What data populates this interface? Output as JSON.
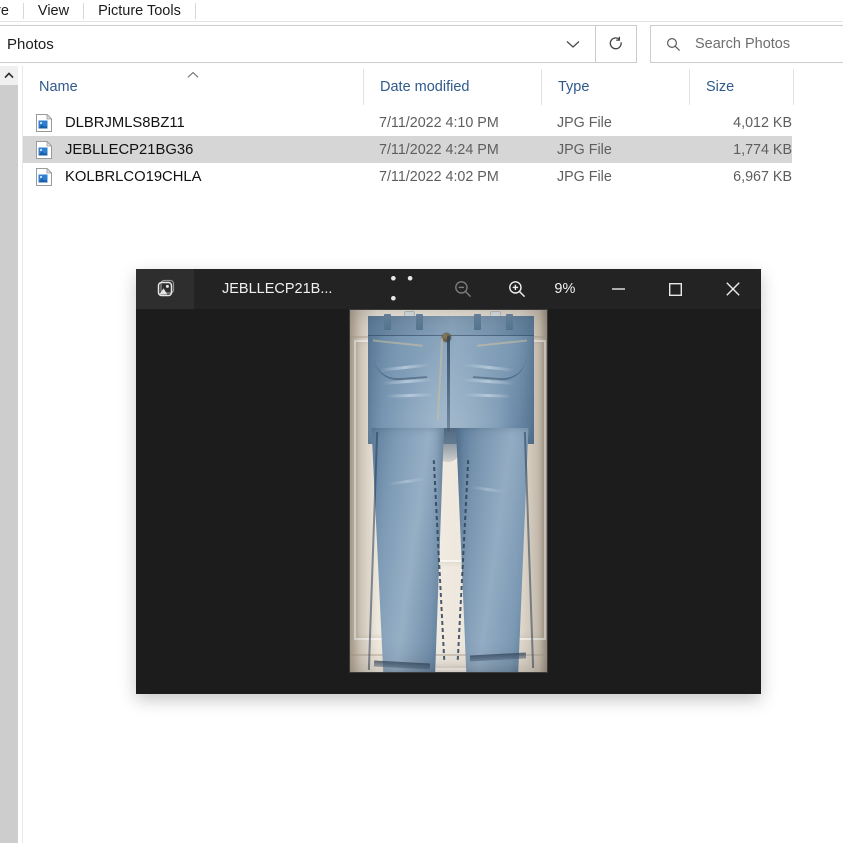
{
  "ribbon": {
    "tabs": [
      {
        "label": "re",
        "name": "tab-share-cut"
      },
      {
        "label": "View",
        "name": "tab-view"
      },
      {
        "label": "Picture Tools",
        "name": "tab-picture-tools"
      }
    ]
  },
  "addressbar": {
    "path": "Photos",
    "dropdown_icon": "chevron-down-icon",
    "refresh_icon": "refresh-icon"
  },
  "search": {
    "placeholder": "Search Photos",
    "icon": "search-icon",
    "value": ""
  },
  "columns": [
    {
      "label": "Name",
      "sorted": "asc"
    },
    {
      "label": "Date modified",
      "sorted": ""
    },
    {
      "label": "Type",
      "sorted": ""
    },
    {
      "label": "Size",
      "sorted": ""
    }
  ],
  "files": [
    {
      "name": "DLBRJMLS8BZ11",
      "date_modified": "7/11/2022 4:10 PM",
      "type": "JPG File",
      "size": "4,012 KB",
      "selected": false
    },
    {
      "name": "JEBLLECP21BG36",
      "date_modified": "7/11/2022 4:24 PM",
      "type": "JPG File",
      "size": "1,774 KB",
      "selected": true
    },
    {
      "name": "KOLBRLCO19CHLA",
      "date_modified": "7/11/2022 4:02 PM",
      "type": "JPG File",
      "size": "6,967 KB",
      "selected": false
    }
  ],
  "viewer": {
    "app_icon": "photos-app-icon",
    "title": "JEBLLECP21B...",
    "more_label": "• • •",
    "zoom_out_icon": "zoom-out-icon",
    "zoom_in_icon": "zoom-in-icon",
    "zoom_level": "9%",
    "minimize_icon": "minimize-icon",
    "maximize_icon": "maximize-icon",
    "close_icon": "close-icon",
    "photo_alt": "blue-jeans-hanging-on-white-door"
  },
  "colors": {
    "selection": "#d6d6d6",
    "column_header_text": "#2f5a8c",
    "viewer_titlebar": "#232323",
    "viewer_canvas": "#1c1c1c",
    "scrollbar_thumb": "#cdcdcd"
  }
}
